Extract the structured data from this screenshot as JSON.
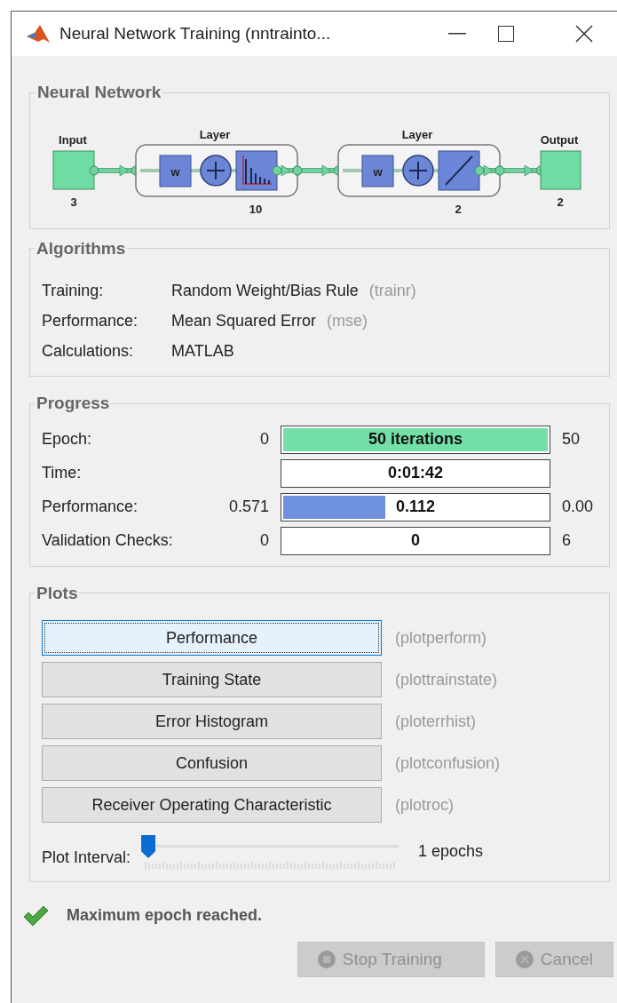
{
  "window": {
    "title": "Neural Network Training (nntrainto..."
  },
  "network": {
    "title": "Neural Network",
    "input": {
      "label": "Input",
      "size": "3"
    },
    "layers": [
      {
        "label": "Layer",
        "size": "10",
        "weight": "w",
        "kind": "bars"
      },
      {
        "label": "Layer",
        "size": "2",
        "weight": "w",
        "kind": "linear"
      }
    ],
    "output": {
      "label": "Output",
      "size": "2"
    }
  },
  "algorithms": {
    "title": "Algorithms",
    "rows": [
      {
        "label": "Training:",
        "value": "Random Weight/Bias Rule",
        "code": "(trainr)"
      },
      {
        "label": "Performance:",
        "value": "Mean Squared Error",
        "code": "(mse)"
      },
      {
        "label": "Calculations:",
        "value": "MATLAB"
      }
    ]
  },
  "progress": {
    "title": "Progress",
    "rows": [
      {
        "label": "Epoch:",
        "start": "0",
        "value": "50 iterations",
        "end": "50",
        "level": 1,
        "color": "#73dfa9"
      },
      {
        "label": "Time:",
        "value": "0:01:42"
      },
      {
        "label": "Performance:",
        "start": "0.571",
        "value": "0.112",
        "end": "0.00",
        "level": 0.385,
        "color": "#7090e0"
      },
      {
        "label": "Validation Checks:",
        "start": "0",
        "value": "0",
        "end": "6"
      }
    ]
  },
  "plots": {
    "title": "Plots",
    "buttons": [
      {
        "label": "Performance",
        "function": "(plotperform)",
        "selected": true
      },
      {
        "label": "Training State",
        "function": "(plottrainstate)",
        "selected": false
      },
      {
        "label": "Error Histogram",
        "function": "(ploterrhist)",
        "selected": false
      },
      {
        "label": "Confusion",
        "function": "(plotconfusion)",
        "selected": false
      },
      {
        "label": "Receiver Operating Characteristic",
        "function": "(plotroc)",
        "selected": false
      }
    ],
    "interval": {
      "label": "Plot Interval:",
      "level": 0,
      "reading": "1 epochs"
    }
  },
  "status": {
    "text": "Maximum epoch reached."
  },
  "buttons": [
    {
      "label": "Stop Training",
      "kind": "stop",
      "disabled": true
    },
    {
      "label": "Cancel",
      "kind": "cancel",
      "disabled": true
    }
  ]
}
